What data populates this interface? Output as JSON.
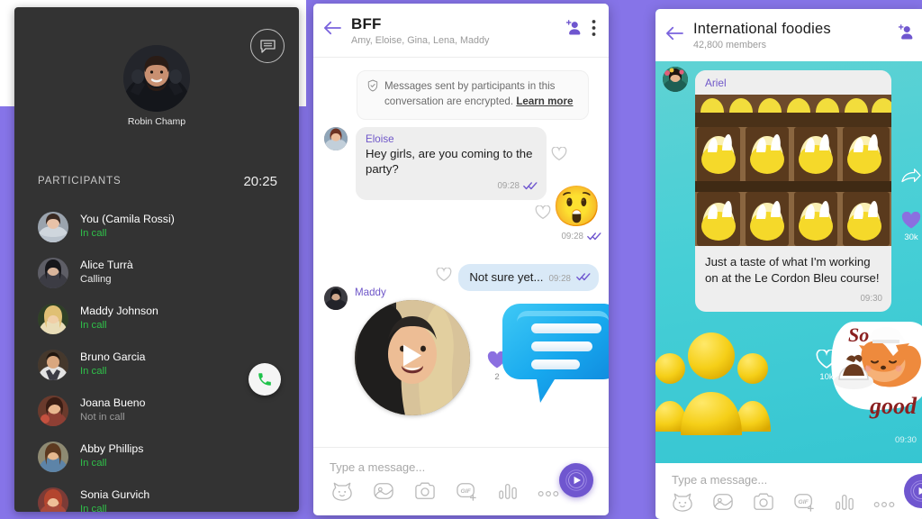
{
  "call_screen": {
    "chat_icon": "chat-bubble-icon",
    "caller_name": "Robin Champ",
    "participants_label": "PARTICIPANTS",
    "timer": "20:25",
    "answer_icon": "phone-icon",
    "participants": [
      {
        "name": "You (Camila Rossi)",
        "status": "In call",
        "state": "incall"
      },
      {
        "name": "Alice Turrà",
        "status": "Calling",
        "state": "calling"
      },
      {
        "name": "Maddy Johnson",
        "status": "In call",
        "state": "incall"
      },
      {
        "name": "Bruno Garcia",
        "status": "In call",
        "state": "incall"
      },
      {
        "name": "Joana Bueno",
        "status": "Not in call",
        "state": "notincall"
      },
      {
        "name": "Abby Phillips",
        "status": "In call",
        "state": "incall"
      },
      {
        "name": "Sonia Gurvich",
        "status": "In call",
        "state": "incall"
      }
    ]
  },
  "chat_screen": {
    "back_icon": "back-arrow-icon",
    "title": "BFF",
    "subtitle": "Amy, Eloise, Gina, Lena, Maddy",
    "add_person_icon": "add-person-icon",
    "overflow_icon": "more-vertical-icon",
    "encryption": {
      "shield_icon": "shield-check-icon",
      "text": "Messages sent by participants in this conversation are encrypted.",
      "link": "Learn more"
    },
    "messages": [
      {
        "sender": "Eloise",
        "text": "Hey girls, are you coming to the party?",
        "time": "09:28",
        "type": "incoming-text"
      },
      {
        "sender": "",
        "text": "",
        "emoji": "😲",
        "time": "09:28",
        "type": "outgoing-emoji"
      },
      {
        "sender": "",
        "text": "Not sure yet...",
        "time": "09:28",
        "type": "outgoing-text"
      },
      {
        "sender": "Maddy",
        "text": "",
        "time": "",
        "type": "incoming-video",
        "reaction": "💜",
        "reaction_count": "2"
      }
    ],
    "composer": {
      "placeholder": "Type a message...",
      "icons": [
        "sticker-cat-icon",
        "gallery-icon",
        "camera-icon",
        "gif-icon",
        "poll-icon",
        "more-horizontal-icon"
      ],
      "send_icon": "send-play-icon"
    }
  },
  "community_screen": {
    "back_icon": "back-arrow-icon",
    "title": "International foodies",
    "members": "42,800 members",
    "add_person_icon": "add-person-icon",
    "post": {
      "sender": "Ariel",
      "text": "Just a taste of what I'm working on at the Le Cordon Bleu course!",
      "time": "09:30"
    },
    "rail": {
      "share_icon": "share-arrow-icon",
      "like_icon": "heart-filled-icon",
      "like_count": "30k"
    },
    "reaction": {
      "like_icon": "heart-outline-icon",
      "like_count": "10k"
    },
    "sticker": {
      "name": "so-good-fox-sticker",
      "top_text": "So",
      "bottom_text": "good",
      "time": "09:30"
    },
    "composer": {
      "placeholder": "Type a message...",
      "icons": [
        "sticker-cat-icon",
        "gallery-icon",
        "camera-icon",
        "gif-icon",
        "poll-icon",
        "more-horizontal-icon"
      ],
      "send_icon": "send-play-icon"
    }
  },
  "theme": {
    "accent_purple": "#8674e8",
    "send_purple": "#6f56cf",
    "sender_purple": "#6f57c9",
    "in_call_green": "#2fc04a",
    "community_teal": "#47cfd6",
    "dark_panel": "#333333"
  }
}
